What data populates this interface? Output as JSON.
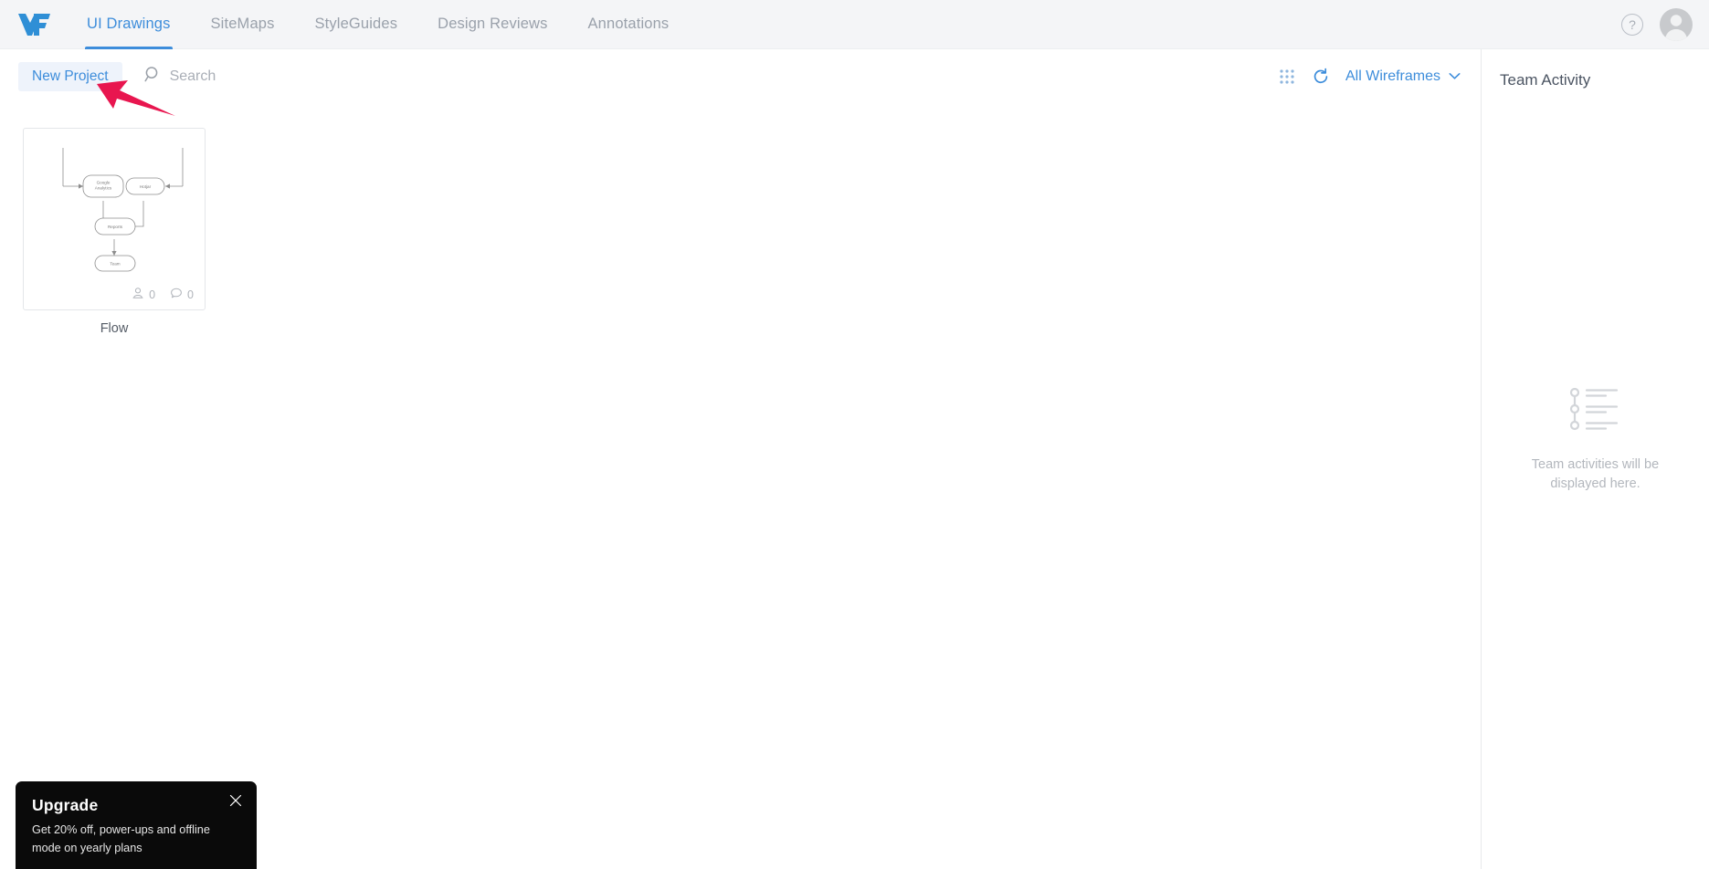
{
  "app": {
    "logo_icon": "wireframe-logo-icon",
    "brand_color": "#3d8ddb",
    "accent_color": "#e8164f"
  },
  "topnav": {
    "tabs": [
      {
        "label": "UI Drawings",
        "active": true
      },
      {
        "label": "SiteMaps",
        "active": false
      },
      {
        "label": "StyleGuides",
        "active": false
      },
      {
        "label": "Design Reviews",
        "active": false
      },
      {
        "label": "Annotations",
        "active": false
      }
    ],
    "help_label": "?",
    "help_icon": "question-mark-icon",
    "avatar_icon": "user-avatar-icon"
  },
  "toolbar": {
    "new_project_label": "New Project",
    "search_placeholder": "Search",
    "search_value": "",
    "search_icon": "search-icon",
    "grid_view_icon": "grid-view-icon",
    "refresh_icon": "refresh-icon",
    "filter_label": "All Wireframes",
    "filter_chevron_icon": "chevron-down-icon"
  },
  "main": {
    "projects": [
      {
        "title": "Flow",
        "collaborators": "0",
        "comments": "0",
        "collaborators_icon": "person-icon",
        "comments_icon": "comment-bubble-icon",
        "thumbnail": {
          "type": "flowchart",
          "nodes": [
            {
              "label": "Google Analytics"
            },
            {
              "label": "Hotjar"
            },
            {
              "label": "Reports"
            },
            {
              "label": "Team"
            }
          ]
        }
      }
    ]
  },
  "sidebar": {
    "title": "Team Activity",
    "empty_icon": "activity-timeline-icon",
    "empty_text": "Team activities will be displayed here."
  },
  "toast": {
    "title": "Upgrade",
    "body": "Get 20% off, power-ups and offline mode on yearly plans",
    "close_icon": "close-icon"
  },
  "annotation": {
    "arrow_icon": "pointer-arrow-icon",
    "color": "#e8164f"
  }
}
